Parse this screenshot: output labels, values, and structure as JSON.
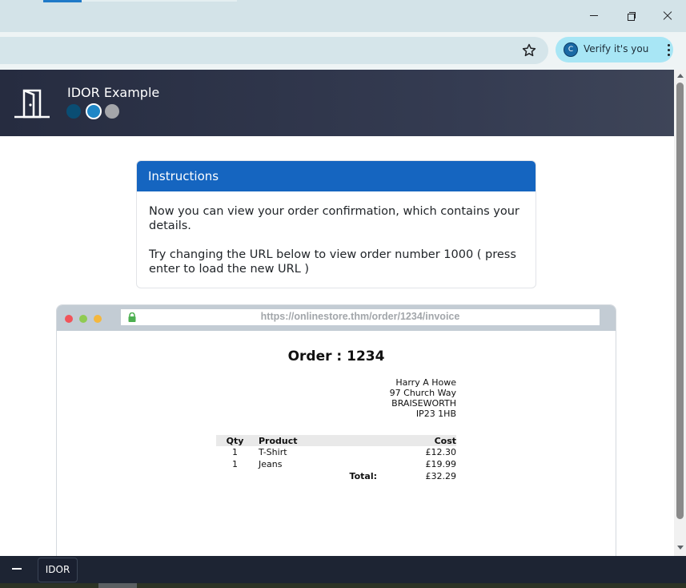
{
  "browser": {
    "verify_label": "Verify it's you",
    "verify_avatar_letter": "C",
    "accent": "#1f7ac8"
  },
  "app": {
    "title": "IDOR Example",
    "step_dots": [
      "#0a4d73",
      "#1e86c6",
      "#a4a6aa"
    ]
  },
  "instructions": {
    "header": "Instructions",
    "paragraph1": "Now you can view your order confirmation, which contains your details.",
    "paragraph2": "Try changing the URL below to view order number 1000 ( press enter to load the new URL )",
    "header_color": "#1565c0"
  },
  "mock_browser": {
    "url": "https://onlinestore.thm/order/1234/invoice"
  },
  "invoice": {
    "title": "Order : 1234",
    "address": [
      "Harry A Howe",
      "97 Church Way",
      "BRAISEWORTH",
      "IP23 1HB"
    ],
    "columns": {
      "qty": "Qty",
      "product": "Product",
      "cost": "Cost"
    },
    "items": [
      {
        "qty": "1",
        "product": "T-Shirt",
        "cost": "£12.30"
      },
      {
        "qty": "1",
        "product": "Jeans",
        "cost": "£19.99"
      }
    ],
    "total_label": "Total:",
    "total_value": "£32.29"
  },
  "taskbar": {
    "item_label": "IDOR"
  }
}
